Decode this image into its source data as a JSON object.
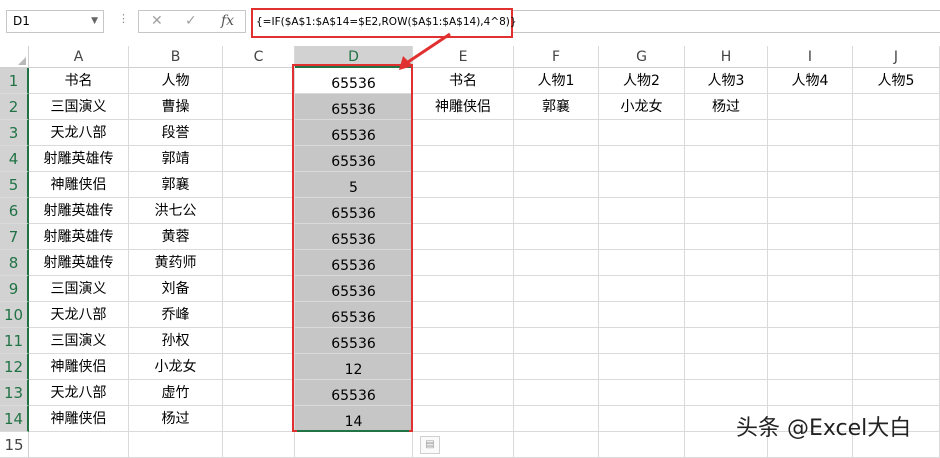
{
  "formula_bar": {
    "name_box": "D1",
    "cancel_glyph": "✕",
    "enter_glyph": "✓",
    "fx_label": "fx",
    "formula": "{=IF($A$1:$A$14=$E2,ROW($A$1:$A$14),4^8)}"
  },
  "columns": [
    "A",
    "B",
    "C",
    "D",
    "E",
    "F",
    "G",
    "H",
    "I",
    "J"
  ],
  "rows": [
    "1",
    "2",
    "3",
    "4",
    "5",
    "6",
    "7",
    "8",
    "9",
    "10",
    "11",
    "12",
    "13",
    "14",
    "15"
  ],
  "cells": {
    "A": [
      "书名",
      "三国演义",
      "天龙八部",
      "射雕英雄传",
      "神雕侠侣",
      "射雕英雄传",
      "射雕英雄传",
      "射雕英雄传",
      "三国演义",
      "天龙八部",
      "三国演义",
      "神雕侠侣",
      "天龙八部",
      "神雕侠侣"
    ],
    "B": [
      "人物",
      "曹操",
      "段誉",
      "郭靖",
      "郭襄",
      "洪七公",
      "黄蓉",
      "黄药师",
      "刘备",
      "乔峰",
      "孙权",
      "小龙女",
      "虚竹",
      "杨过"
    ],
    "D": [
      "65536",
      "65536",
      "65536",
      "65536",
      "5",
      "65536",
      "65536",
      "65536",
      "65536",
      "65536",
      "65536",
      "12",
      "65536",
      "14"
    ],
    "row1": {
      "E": "书名",
      "F": "人物1",
      "G": "人物2",
      "H": "人物3",
      "I": "人物4",
      "J": "人物5"
    },
    "row2": {
      "E": "神雕侠侣",
      "F": "郭襄",
      "G": "小龙女",
      "H": "杨过"
    }
  },
  "watermark": "头条 @Excel大白",
  "colors": {
    "accent_red": "#e03030",
    "excel_green": "#217346",
    "highlight": "#c6c6c6"
  },
  "icons": [
    "dropdown-icon",
    "cancel-icon",
    "enter-icon",
    "fx-icon",
    "paste-options-icon"
  ]
}
